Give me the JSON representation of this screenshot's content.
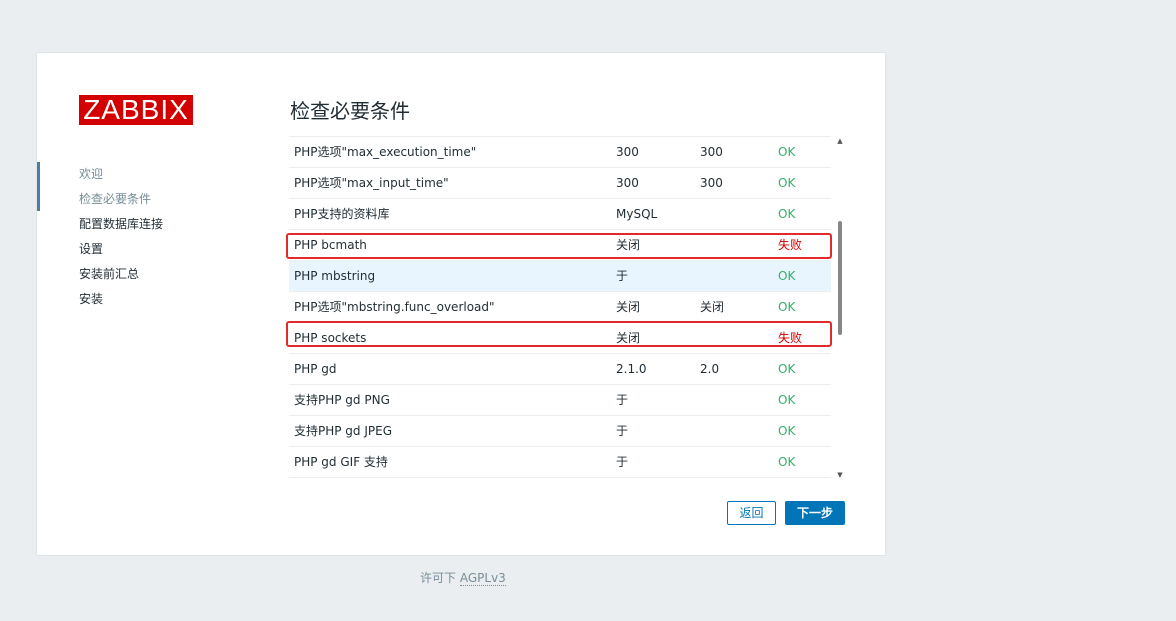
{
  "logo": {
    "text": "ZABBIX"
  },
  "sidebar": {
    "items": [
      {
        "label": "欢迎"
      },
      {
        "label": "检查必要条件"
      },
      {
        "label": "配置数据库连接"
      },
      {
        "label": "设置"
      },
      {
        "label": "安装前汇总"
      },
      {
        "label": "安装"
      }
    ]
  },
  "main": {
    "title": "检查必要条件",
    "rows": [
      {
        "name": "PHP选项\"max_execution_time\"",
        "current": "300",
        "required": "300",
        "result": "OK"
      },
      {
        "name": "PHP选项\"max_input_time\"",
        "current": "300",
        "required": "300",
        "result": "OK"
      },
      {
        "name": "PHP支持的资料库",
        "current": "MySQL",
        "required": "",
        "result": "OK"
      },
      {
        "name": "PHP bcmath",
        "current": "关闭",
        "required": "",
        "result": "失败"
      },
      {
        "name": "PHP mbstring",
        "current": "于",
        "required": "",
        "result": "OK"
      },
      {
        "name": "PHP选项\"mbstring.func_overload\"",
        "current": "关闭",
        "required": "关闭",
        "result": "OK"
      },
      {
        "name": "PHP sockets",
        "current": "关闭",
        "required": "",
        "result": "失败"
      },
      {
        "name": "PHP gd",
        "current": "2.1.0",
        "required": "2.0",
        "result": "OK"
      },
      {
        "name": "支持PHP gd PNG",
        "current": "于",
        "required": "",
        "result": "OK"
      },
      {
        "name": "支持PHP gd JPEG",
        "current": "于",
        "required": "",
        "result": "OK"
      },
      {
        "name": "PHP gd GIF 支持",
        "current": "于",
        "required": "",
        "result": "OK"
      }
    ]
  },
  "buttons": {
    "back": "返回",
    "next": "下一步"
  },
  "footer": {
    "prefix": "许可下",
    "link": "AGPLv3"
  },
  "colors": {
    "background": "#ebeef0",
    "logo_red": "#d40000",
    "ok_green": "#34af67",
    "fail_red": "#d40000",
    "primary_blue": "#0275b8",
    "highlight_box": "#e32a2a",
    "hover_row": "#e8f5ff"
  },
  "icons": {
    "scroll_up": "scroll-up-arrow-icon",
    "scroll_down": "scroll-down-arrow-icon"
  }
}
